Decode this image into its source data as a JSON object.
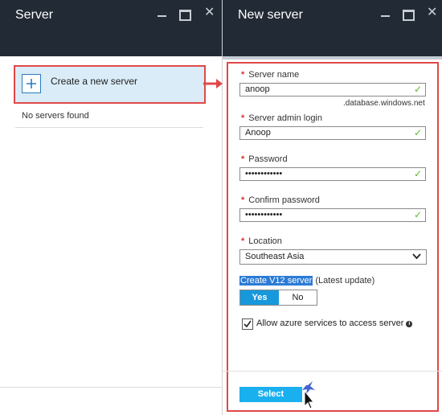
{
  "left_blade": {
    "title": "Server",
    "create_label": "Create a new server",
    "empty_text": "No servers found"
  },
  "right_blade": {
    "title": "New server",
    "fields": {
      "server_name": {
        "label": "Server name",
        "value": "anoop",
        "suffix": ".database.windows.net"
      },
      "admin_login": {
        "label": "Server admin login",
        "value": "Anoop"
      },
      "password": {
        "label": "Password",
        "value": "••••••••••••"
      },
      "confirm_password": {
        "label": "Confirm password",
        "value": "••••••••••••"
      },
      "location": {
        "label": "Location",
        "value": "Southeast Asia"
      }
    },
    "v12": {
      "label_highlight": "Create V12 server",
      "label_rest": " (Latest update)",
      "yes": "Yes",
      "no": "No",
      "selected": "Yes"
    },
    "allow_azure": {
      "label": "Allow azure services to access server",
      "checked": true
    },
    "select_button": "Select"
  },
  "required_mark": "*",
  "colors": {
    "header_bg": "#222a35",
    "accent": "#1798db",
    "highlight_border": "#e04848",
    "valid_check": "#5cb82d"
  },
  "icons": [
    "plus-icon",
    "minimize-icon",
    "maximize-icon",
    "close-icon",
    "check-icon",
    "chevron-down-icon",
    "info-icon",
    "arrow-right-icon",
    "cursor-icon"
  ]
}
